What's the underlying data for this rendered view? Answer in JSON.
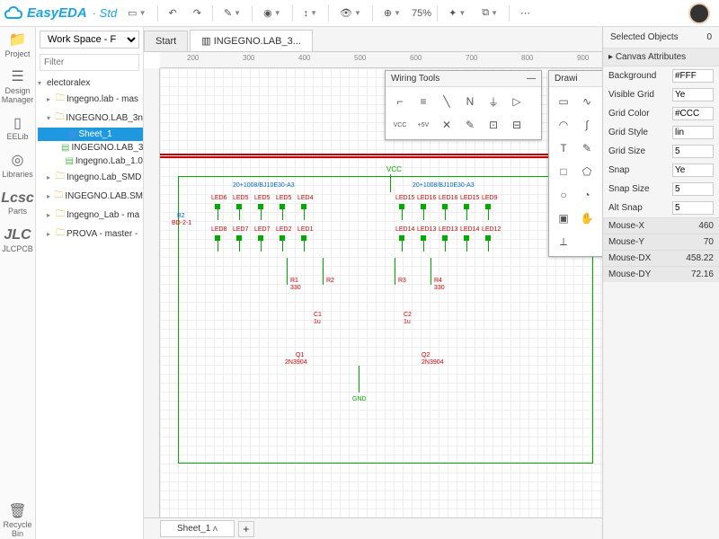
{
  "app": {
    "name": "EasyEDA",
    "edition": "Std"
  },
  "toolbar": {
    "zoom": "75%"
  },
  "workspace_select": "Work Space - F",
  "filter_placeholder": "Filter",
  "rail": [
    {
      "icon": "📁",
      "label": "Project"
    },
    {
      "icon": "⚙",
      "label": "Design\nManager"
    },
    {
      "icon": "⧈",
      "label": "EELib"
    },
    {
      "icon": "◎",
      "label": "Libraries"
    },
    {
      "icon": "L",
      "label": "Parts"
    },
    {
      "icon": "J",
      "label": "JLCPCB"
    }
  ],
  "rail_bottom": {
    "icon": "🗑",
    "label": "Recycle\nBin"
  },
  "tree": {
    "root": "electoralex",
    "nodes": [
      {
        "indent": 1,
        "tri": "▸",
        "ico": "folder",
        "label": "Ingegno.lab - mas"
      },
      {
        "indent": 1,
        "tri": "▾",
        "ico": "folder",
        "label": "INGEGNO.LAB_3n"
      },
      {
        "indent": 2,
        "ico": "sheet",
        "label": "Sheet_1",
        "sel": true
      },
      {
        "indent": 2,
        "ico": "sheet2",
        "label": "INGEGNO.LAB_3"
      },
      {
        "indent": 2,
        "ico": "sheet2",
        "label": "Ingegno.Lab_1.0"
      },
      {
        "indent": 1,
        "tri": "▸",
        "ico": "folder",
        "label": "Ingegno.Lab_SMD"
      },
      {
        "indent": 1,
        "tri": "▸",
        "ico": "folder",
        "label": "INGEGNO.LAB.SM"
      },
      {
        "indent": 1,
        "tri": "▸",
        "ico": "folder",
        "label": "Ingegno_Lab - ma"
      },
      {
        "indent": 1,
        "tri": "▸",
        "ico": "folder",
        "label": "PROVA - master -"
      }
    ]
  },
  "tabs": [
    {
      "label": "Start",
      "active": false
    },
    {
      "label": "INGEGNO.LAB_3...",
      "active": true
    }
  ],
  "ruler_marks": [
    "200",
    "300",
    "400",
    "500",
    "600",
    "700",
    "800",
    "900"
  ],
  "wiring_panel_title": "Wiring Tools",
  "drawing_panel_title": "Drawi",
  "sheet_tab": "Sheet_1",
  "right": {
    "selected_label": "Selected Objects",
    "selected_count": "0",
    "canvas_attr_label": "Canvas Attributes",
    "attrs": [
      {
        "k": "Background",
        "v": "#FFF"
      },
      {
        "k": "Visible Grid",
        "v": "Ye"
      },
      {
        "k": "Grid Color",
        "v": "#CCC"
      },
      {
        "k": "Grid Style",
        "v": "lin"
      },
      {
        "k": "Grid Size",
        "v": "5"
      },
      {
        "k": "Snap",
        "v": "Ye"
      },
      {
        "k": "Snap Size",
        "v": "5"
      },
      {
        "k": "Alt Snap",
        "v": "5"
      }
    ],
    "stats": [
      {
        "k": "Mouse-X",
        "v": "460"
      },
      {
        "k": "Mouse-Y",
        "v": "70"
      },
      {
        "k": "Mouse-DX",
        "v": "458.22"
      },
      {
        "k": "Mouse-DY",
        "v": "72.16"
      }
    ]
  },
  "schematic": {
    "vcc": "VCC",
    "gnd": "GND",
    "block_label_l": "20+1008/BJ10E30-A3",
    "block_label_r": "20+1008/BJ10E30-A3",
    "leds_top_l": [
      "LED6",
      "LED5",
      "LED5",
      "LED5",
      "LED4"
    ],
    "leds_top_r": [
      "LED15",
      "LED16",
      "LED16",
      "LED15",
      "LED9"
    ],
    "leds_bot_l": [
      "LED8",
      "LED7",
      "LED7",
      "LED2",
      "LED1"
    ],
    "leds_bot_r": [
      "LED14",
      "LED13",
      "LED13",
      "LED14",
      "LED12"
    ],
    "r": [
      "R1",
      "R2",
      "R3",
      "R4"
    ],
    "rval": "330",
    "cap": [
      "C1",
      "C2"
    ],
    "capval": "1u",
    "q": [
      "Q1",
      "Q2"
    ],
    "qval": "2N3904",
    "b": "B2",
    "bval": "BD-2-1"
  }
}
